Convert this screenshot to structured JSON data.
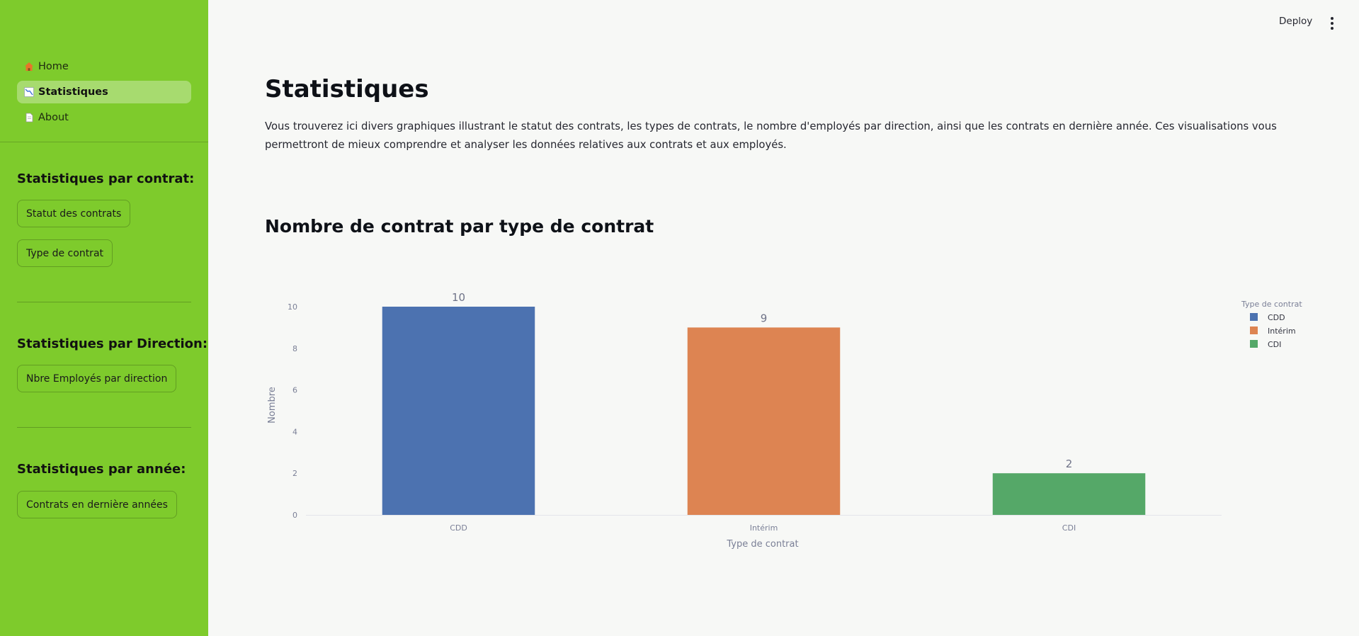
{
  "sidebar": {
    "nav": [
      {
        "label": "Home",
        "icon": "house-icon"
      },
      {
        "label": "Statistiques",
        "icon": "chart-decreasing-icon"
      },
      {
        "label": "About",
        "icon": "page-icon"
      }
    ],
    "sections": [
      {
        "title": "Statistiques par contrat:",
        "buttons": [
          "Statut des contrats",
          "Type de contrat"
        ]
      },
      {
        "title": "Statistiques par Direction:",
        "buttons": [
          "Nbre Employés par direction"
        ]
      },
      {
        "title": "Statistiques par année:",
        "buttons": [
          "Contrats en dernière années"
        ]
      }
    ]
  },
  "header": {
    "deploy_label": "Deploy",
    "menu_icon": "more-vertical-icon"
  },
  "main": {
    "title": "Statistiques",
    "intro": "Vous trouverez ici divers graphiques illustrant le statut des contrats, les types de contrats, le nombre d'employés par direction, ainsi que les contrats en dernière année. Ces visualisations vous permettront de mieux comprendre et analyser les données relatives aux contrats et aux employés.",
    "chart_heading": "Nombre de contrat par type de contrat"
  },
  "chart_data": {
    "type": "bar",
    "categories": [
      "CDD",
      "Intérim",
      "CDI"
    ],
    "values": [
      10,
      9,
      2
    ],
    "colors": [
      "#4c72b0",
      "#dd8452",
      "#55a868"
    ],
    "xlabel": "Type de contrat",
    "ylabel": "Nombre",
    "ylim": [
      0,
      10
    ],
    "yticks": [
      0,
      2,
      4,
      6,
      8,
      10
    ],
    "legend_title": "Type de contrat",
    "legend_position": "top-right",
    "data_labels": true,
    "grid": false
  }
}
